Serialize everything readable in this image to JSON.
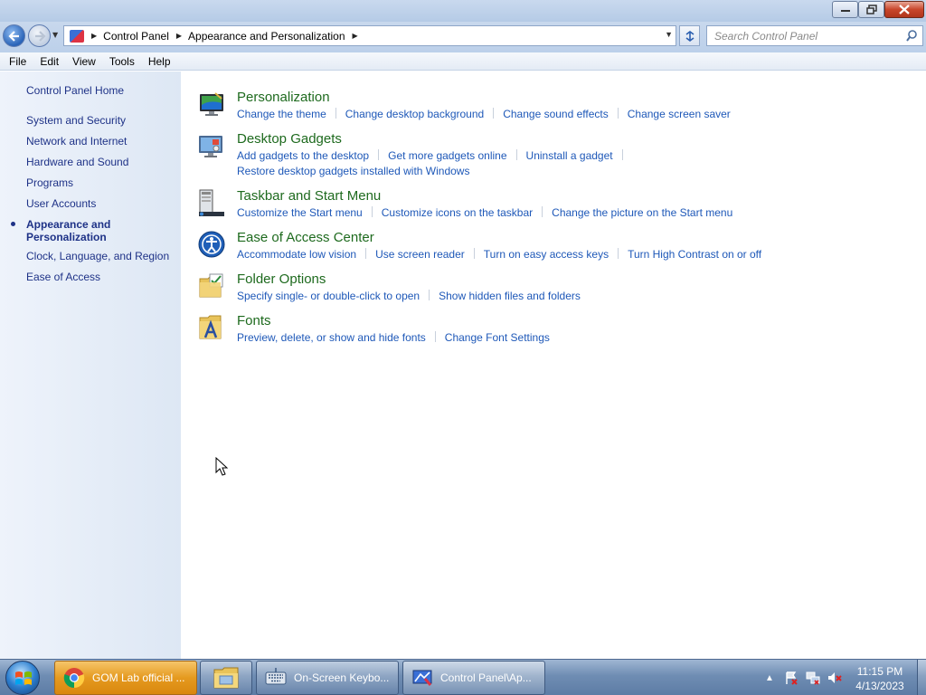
{
  "window": {
    "minimize_label": "▭",
    "maximize_label": "❐",
    "close_label": "✕"
  },
  "address": {
    "crumbs": [
      "Control Panel",
      "Appearance and Personalization"
    ],
    "search_placeholder": "Search Control Panel"
  },
  "menu": [
    "File",
    "Edit",
    "View",
    "Tools",
    "Help"
  ],
  "sidebar": {
    "home": "Control Panel Home",
    "items": [
      {
        "label": "System and Security"
      },
      {
        "label": "Network and Internet"
      },
      {
        "label": "Hardware and Sound"
      },
      {
        "label": "Programs"
      },
      {
        "label": "User Accounts"
      },
      {
        "label": "Appearance and Personalization",
        "active": true
      },
      {
        "label": "Clock, Language, and Region"
      },
      {
        "label": "Ease of Access"
      }
    ]
  },
  "categories": [
    {
      "title": "Personalization",
      "icon": "personalization-icon",
      "links": [
        "Change the theme",
        "Change desktop background",
        "Change sound effects",
        "Change screen saver"
      ]
    },
    {
      "title": "Desktop Gadgets",
      "icon": "gadgets-icon",
      "links": [
        "Add gadgets to the desktop",
        "Get more gadgets online",
        "Uninstall a gadget",
        "Restore desktop gadgets installed with Windows"
      ]
    },
    {
      "title": "Taskbar and Start Menu",
      "icon": "taskbar-icon",
      "links": [
        "Customize the Start menu",
        "Customize icons on the taskbar",
        "Change the picture on the Start menu"
      ]
    },
    {
      "title": "Ease of Access Center",
      "icon": "ease-of-access-icon",
      "links": [
        "Accommodate low vision",
        "Use screen reader",
        "Turn on easy access keys",
        "Turn High Contrast on or off"
      ]
    },
    {
      "title": "Folder Options",
      "icon": "folder-options-icon",
      "links": [
        "Specify single- or double-click to open",
        "Show hidden files and folders"
      ]
    },
    {
      "title": "Fonts",
      "icon": "fonts-icon",
      "links": [
        "Preview, delete, or show and hide fonts",
        "Change Font Settings"
      ]
    }
  ],
  "taskbar": {
    "buttons": [
      {
        "label": "GOM Lab official ...",
        "icon": "chrome-icon"
      },
      {
        "label": "",
        "icon": "file-explorer-icon"
      },
      {
        "label": "On-Screen Keybo...",
        "icon": "keyboard-icon"
      },
      {
        "label": "Control Panel\\Ap...",
        "icon": "control-panel-icon"
      }
    ],
    "clock_time": "11:15 PM",
    "clock_date": "4/13/2023"
  },
  "colors": {
    "link": "#1e58b8",
    "category_title": "#1e6a1e",
    "nav_text": "#1e3287"
  }
}
